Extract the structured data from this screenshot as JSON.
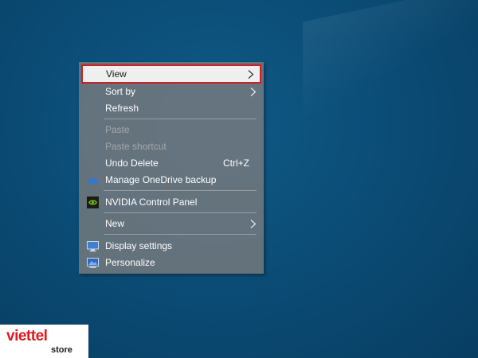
{
  "menu": {
    "items": [
      {
        "label": "View",
        "has_submenu": true,
        "highlighted": true
      },
      {
        "label": "Sort by",
        "has_submenu": true
      },
      {
        "label": "Refresh"
      },
      {
        "label": "Paste",
        "disabled": true
      },
      {
        "label": "Paste shortcut",
        "disabled": true
      },
      {
        "label": "Undo Delete",
        "shortcut": "Ctrl+Z"
      },
      {
        "label": "Manage OneDrive backup",
        "icon": "onedrive-cloud-icon"
      },
      {
        "label": "NVIDIA Control Panel",
        "icon": "nvidia-icon"
      },
      {
        "label": "New",
        "has_submenu": true
      },
      {
        "label": "Display settings",
        "icon": "display-settings-icon"
      },
      {
        "label": "Personalize",
        "icon": "personalize-icon"
      }
    ]
  },
  "watermark": {
    "brand": "viettel",
    "sub": "store"
  },
  "colors": {
    "highlight_border": "#cc1f25",
    "brand_red": "#e0181f",
    "desktop_blue": "#0b4d77"
  }
}
